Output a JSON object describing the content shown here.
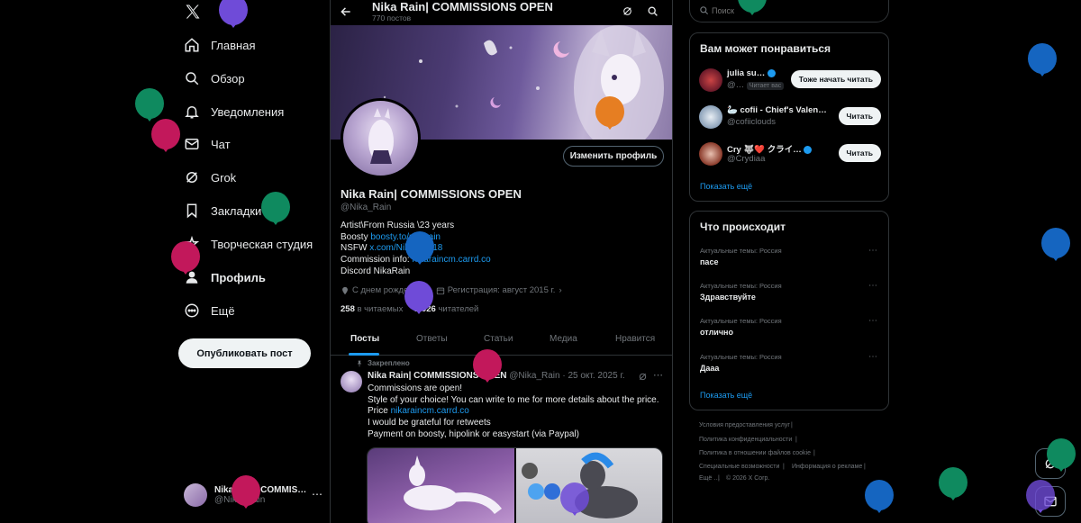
{
  "colors": {
    "accent": "#1d9bf0",
    "background": "#000000",
    "border": "#2f3336",
    "text": "#e7e9ea",
    "muted": "#71767b"
  },
  "nav": {
    "items": [
      {
        "label": "Главная",
        "icon": "home-icon"
      },
      {
        "label": "Обзор",
        "icon": "search-icon"
      },
      {
        "label": "Уведомления",
        "icon": "bell-icon"
      },
      {
        "label": "Чат",
        "icon": "mail-icon"
      },
      {
        "label": "Grok",
        "icon": "grok-icon"
      },
      {
        "label": "Закладки",
        "icon": "bookmark-icon"
      },
      {
        "label": "Творческая студия",
        "icon": "studio-icon"
      },
      {
        "label": "Профиль",
        "icon": "person-icon"
      },
      {
        "label": "Ещё",
        "icon": "more-circle-icon"
      }
    ],
    "post_button": "Опубликовать пост",
    "account": {
      "name": "Nika Rain| COMMIS…",
      "handle": "@Nika_Rain"
    }
  },
  "profile": {
    "header_name": "Nika Rain| COMMISSIONS OPEN",
    "post_count": "770 постов",
    "edit_button": "Изменить профиль",
    "name": "Nika Rain| COMMISSIONS OPEN",
    "handle": "@Nika_Rain",
    "bio": {
      "line1": "Artist\\From Russia \\23 years",
      "boosty_label": "Boosty ",
      "boosty_link": "boosty.to/nikarain",
      "nsfw_label": "NSFW ",
      "nsfw_link": "x.com/NikaRain18",
      "commission_label": "Commission info: ",
      "commission_link": "nikaraincm.carrd.co",
      "discord": "Discord NikaRain"
    },
    "birthday": "С днем рождения!",
    "joined": "Регистрация: август 2015 г.",
    "following_count": "258",
    "following_label": "в читаемых",
    "followers_count": "1 026",
    "followers_label": "читателей"
  },
  "tabs": [
    "Посты",
    "Ответы",
    "Статьи",
    "Медиа",
    "Нравится"
  ],
  "pinned_post": {
    "pinned_label": "Закреплено",
    "author": "Nika Rain| COMMISSIONS OPEN",
    "handle_date": "@Nika_Rain · 25 окт. 2025 г.",
    "lines": [
      "Commissions are open!",
      "Style of your choice! You can write to me for more details about the price."
    ],
    "price_label": "Price ",
    "price_link": "nikaraincm.carrd.co",
    "line4": "I would be grateful for retweets",
    "line5": "Payment on boosty, hipolink or easystart (via Paypal)"
  },
  "search": {
    "placeholder": "Поиск"
  },
  "suggestions": {
    "title": "Вам может понравиться",
    "users": [
      {
        "name": "julia su…",
        "handle": "@…",
        "badge": "Читает вас",
        "button": "Тоже начать читать"
      },
      {
        "name": "🦢 cofii - Chief's Valen…",
        "handle": "@cofiiclouds",
        "button": "Читать"
      },
      {
        "name": "Cry 🐺❤️ クライ…",
        "handle": "@Crydiaa",
        "button": "Читать"
      }
    ],
    "show_more": "Показать ещё"
  },
  "trends": {
    "title": "Что происходит",
    "items": [
      {
        "category": "Актуальные темы: Россия",
        "name": "пасе"
      },
      {
        "category": "Актуальные темы: Россия",
        "name": "Здравствуйте"
      },
      {
        "category": "Актуальные темы: Россия",
        "name": "отлично"
      },
      {
        "category": "Актуальные темы: Россия",
        "name": "Дааа"
      }
    ],
    "show_more": "Показать ещё"
  },
  "footer": {
    "links": [
      "Условия предоставления услуг",
      "Политика конфиденциальности",
      "Политика в отношении файлов cookie",
      "Специальные возможности",
      "Информация о рекламе",
      "Ещё …",
      "© 2026 X Corp."
    ]
  }
}
